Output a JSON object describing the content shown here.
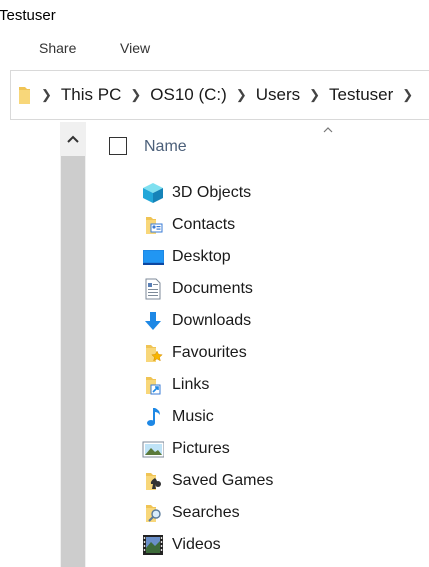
{
  "window": {
    "title": "Testuser"
  },
  "ribbon": {
    "tabs": [
      {
        "label": "Share"
      },
      {
        "label": "View"
      }
    ]
  },
  "address_bar": {
    "crumbs": [
      {
        "label": "This PC"
      },
      {
        "label": "OS10 (C:)"
      },
      {
        "label": "Users"
      },
      {
        "label": "Testuser"
      }
    ]
  },
  "list_header": {
    "name_label": "Name",
    "sort": "ascending"
  },
  "items": [
    {
      "label": "3D Objects",
      "icon": "3d-objects-icon"
    },
    {
      "label": "Contacts",
      "icon": "contacts-folder-icon"
    },
    {
      "label": "Desktop",
      "icon": "desktop-icon"
    },
    {
      "label": "Documents",
      "icon": "documents-icon"
    },
    {
      "label": "Downloads",
      "icon": "downloads-icon"
    },
    {
      "label": "Favourites",
      "icon": "favourites-folder-icon"
    },
    {
      "label": "Links",
      "icon": "links-folder-icon"
    },
    {
      "label": "Music",
      "icon": "music-icon"
    },
    {
      "label": "Pictures",
      "icon": "pictures-icon"
    },
    {
      "label": "Saved Games",
      "icon": "saved-games-folder-icon"
    },
    {
      "label": "Searches",
      "icon": "searches-folder-icon"
    },
    {
      "label": "Videos",
      "icon": "videos-icon"
    }
  ],
  "colors": {
    "header_text": "#4c607a",
    "folder": "#f5c96a",
    "accent": "#1e88e5"
  }
}
